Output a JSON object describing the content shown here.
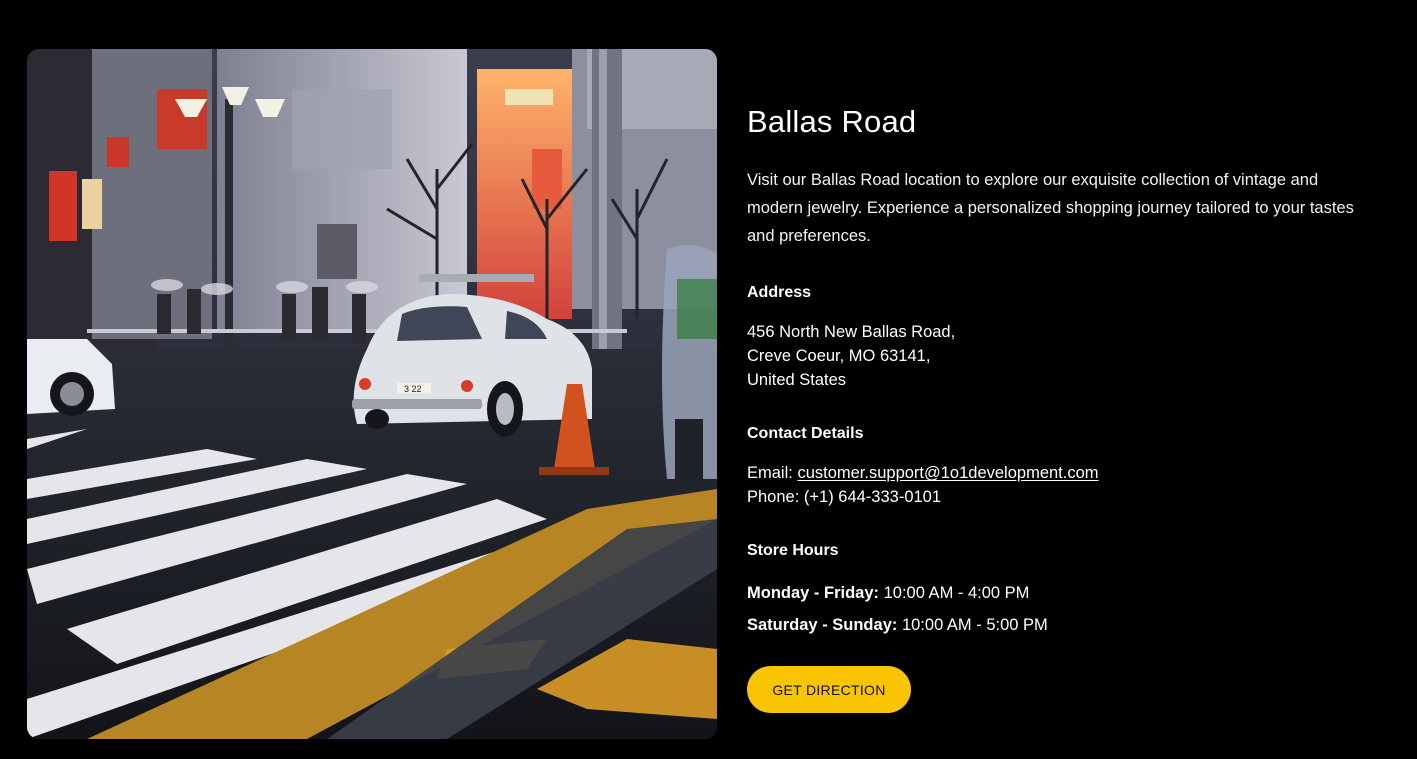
{
  "location": {
    "title": "Ballas Road",
    "description": "Visit our Ballas Road location to explore our exquisite collection of vintage and modern jewelry. Experience a personalized shopping journey tailored to your tastes and preferences."
  },
  "address": {
    "heading": "Address",
    "line1": "456 North New Ballas Road,",
    "line2": "Creve Coeur, MO 63141,",
    "line3": "United States"
  },
  "contact": {
    "heading": "Contact Details",
    "email_label": "Email:",
    "email": "customer.support@1o1development.com",
    "phone_label": "Phone:",
    "phone": "(+1) 644-333-0101"
  },
  "hours": {
    "heading": "Store Hours",
    "rows": [
      {
        "days": "Monday - Friday:",
        "time": "10:00 AM - 4:00 PM"
      },
      {
        "days": "Saturday - Sunday:",
        "time": "10:00 AM - 5:00 PM"
      }
    ]
  },
  "button": {
    "label": "GET DIRECTION"
  },
  "colors": {
    "background": "#000000",
    "accent": "#f9c404",
    "text": "#ffffff"
  },
  "image": {
    "sign_text": "3 22"
  }
}
